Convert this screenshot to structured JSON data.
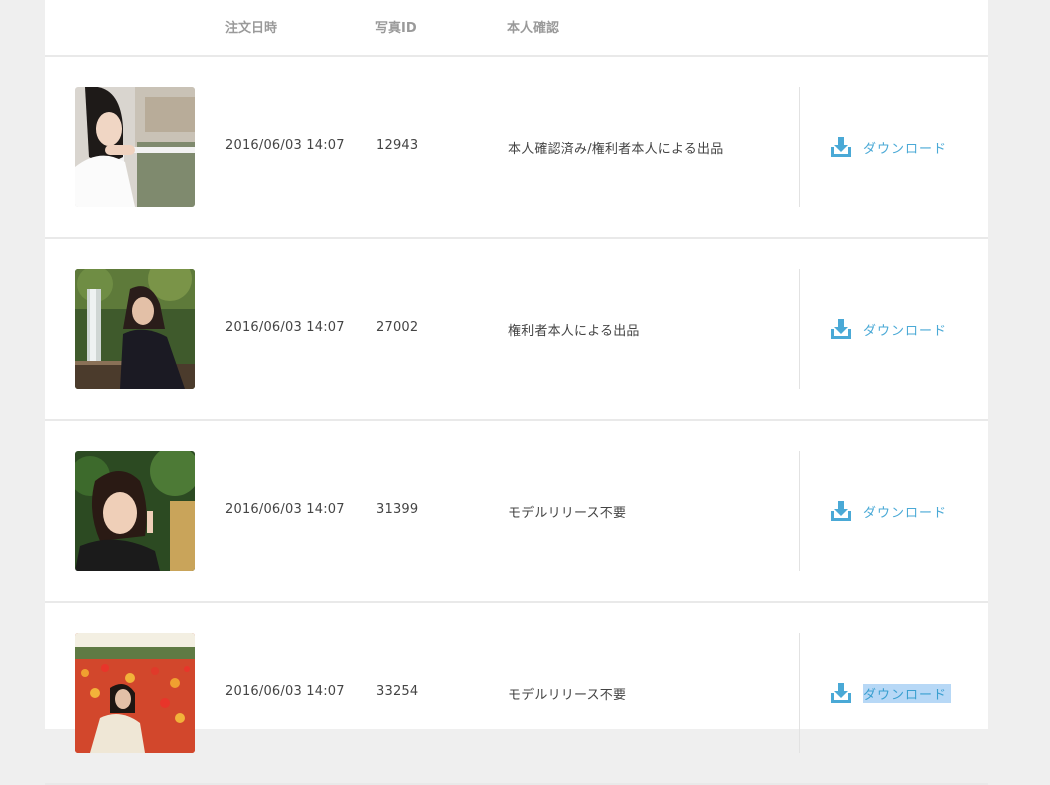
{
  "header": {
    "col_date": "注文日時",
    "col_photo_id": "写真ID",
    "col_verification": "本人確認"
  },
  "orders": [
    {
      "date": "2016/06/03 14:07",
      "photo_id": "12943",
      "verification": "本人確認済み/権利者本人による出品",
      "download_label": "ダウンロード"
    },
    {
      "date": "2016/06/03 14:07",
      "photo_id": "27002",
      "verification": "権利者本人による出品",
      "download_label": "ダウンロード"
    },
    {
      "date": "2016/06/03 14:07",
      "photo_id": "31399",
      "verification": "モデルリリース不要",
      "download_label": "ダウンロード"
    },
    {
      "date": "2016/06/03 14:07",
      "photo_id": "33254",
      "verification": "モデルリリース不要",
      "download_label": "ダウンロード"
    }
  ],
  "icons": {
    "download": "download-icon"
  },
  "colors": {
    "accent": "#4aa9d6",
    "selection": "#b7d8f6"
  }
}
